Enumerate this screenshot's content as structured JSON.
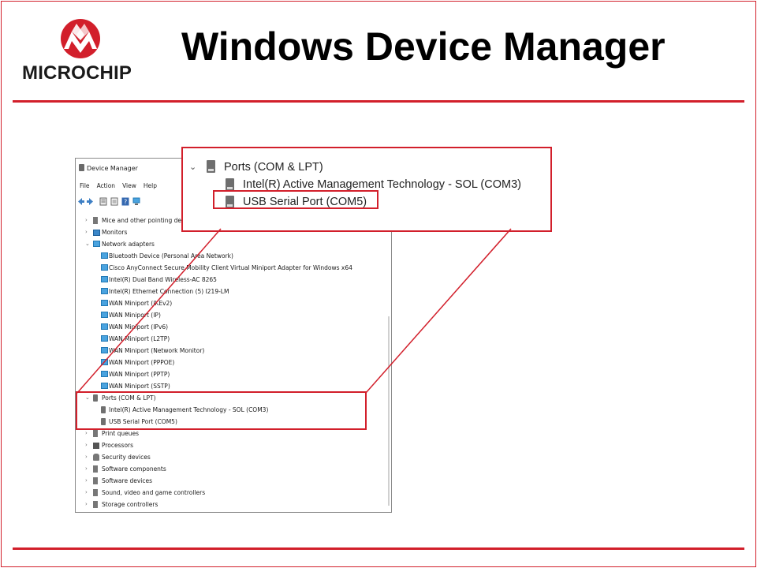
{
  "slide": {
    "title": "Windows Device Manager",
    "logo_text": "MICROCHIP",
    "accent_color": "#d21f2b"
  },
  "device_manager": {
    "window_title": "Device Manager",
    "menu": [
      "File",
      "Action",
      "View",
      "Help"
    ],
    "tree": [
      {
        "label": "Mice and other pointing devices",
        "level": 0,
        "expanded": false,
        "icon": "mouse-icon"
      },
      {
        "label": "Monitors",
        "level": 0,
        "expanded": false,
        "icon": "monitor-icon"
      },
      {
        "label": "Network adapters",
        "level": 0,
        "expanded": true,
        "icon": "network-icon"
      },
      {
        "label": "Bluetooth Device (Personal Area Network)",
        "level": 1,
        "icon": "network-adapter-icon"
      },
      {
        "label": "Cisco AnyConnect Secure Mobility Client Virtual Miniport Adapter for Windows x64",
        "level": 1,
        "icon": "network-adapter-icon"
      },
      {
        "label": "Intel(R) Dual Band Wireless-AC 8265",
        "level": 1,
        "icon": "network-adapter-icon"
      },
      {
        "label": "Intel(R) Ethernet Connection (5) I219-LM",
        "level": 1,
        "icon": "network-adapter-icon"
      },
      {
        "label": "WAN Miniport (IKEv2)",
        "level": 1,
        "icon": "network-adapter-icon"
      },
      {
        "label": "WAN Miniport (IP)",
        "level": 1,
        "icon": "network-adapter-icon"
      },
      {
        "label": "WAN Miniport (IPv6)",
        "level": 1,
        "icon": "network-adapter-icon"
      },
      {
        "label": "WAN Miniport (L2TP)",
        "level": 1,
        "icon": "network-adapter-icon"
      },
      {
        "label": "WAN Miniport (Network Monitor)",
        "level": 1,
        "icon": "network-adapter-icon"
      },
      {
        "label": "WAN Miniport (PPPOE)",
        "level": 1,
        "icon": "network-adapter-icon"
      },
      {
        "label": "WAN Miniport (PPTP)",
        "level": 1,
        "icon": "network-adapter-icon"
      },
      {
        "label": "WAN Miniport (SSTP)",
        "level": 1,
        "icon": "network-adapter-icon"
      },
      {
        "label": "Ports (COM & LPT)",
        "level": 0,
        "expanded": true,
        "icon": "port-icon"
      },
      {
        "label": "Intel(R) Active Management Technology - SOL (COM3)",
        "level": 1,
        "icon": "port-icon"
      },
      {
        "label": "USB Serial Port (COM5)",
        "level": 1,
        "icon": "port-icon"
      },
      {
        "label": "Print queues",
        "level": 0,
        "expanded": false,
        "icon": "printer-icon"
      },
      {
        "label": "Processors",
        "level": 0,
        "expanded": false,
        "icon": "processor-icon"
      },
      {
        "label": "Security devices",
        "level": 0,
        "expanded": false,
        "icon": "security-icon"
      },
      {
        "label": "Software components",
        "level": 0,
        "expanded": false,
        "icon": "component-icon"
      },
      {
        "label": "Software devices",
        "level": 0,
        "expanded": false,
        "icon": "software-icon"
      },
      {
        "label": "Sound, video and game controllers",
        "level": 0,
        "expanded": false,
        "icon": "speaker-icon"
      },
      {
        "label": "Storage controllers",
        "level": 0,
        "expanded": false,
        "icon": "storage-icon"
      }
    ]
  },
  "zoom": {
    "category": "Ports (COM & LPT)",
    "items": [
      "Intel(R) Active Management Technology - SOL (COM3)",
      "USB Serial Port (COM5)"
    ]
  }
}
